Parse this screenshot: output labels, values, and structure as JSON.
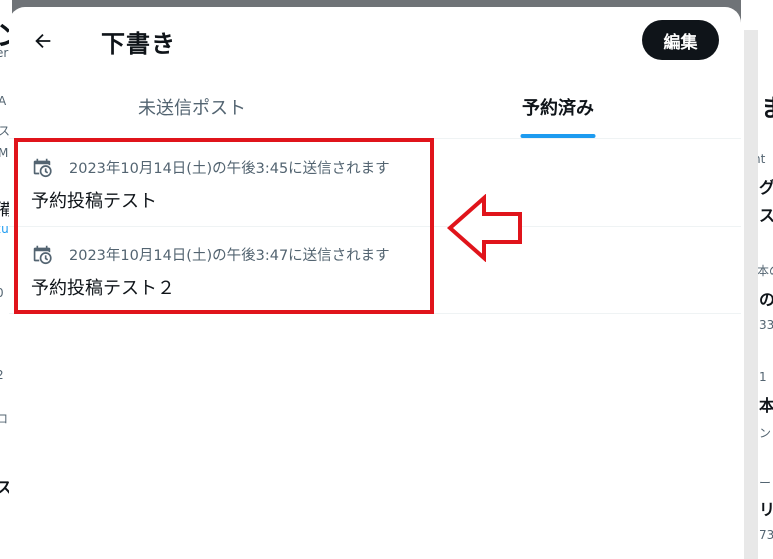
{
  "background": {
    "left_fragments": [
      "ン",
      "er",
      "A",
      "ス",
      "M",
      "備",
      "xu",
      "0",
      "2",
      "ロ",
      "ス"
    ],
    "right_fragments": [
      "ま",
      "nt",
      "グ",
      "ス",
      "本の",
      "の",
      "33",
      "1",
      "本",
      "ン",
      "ー",
      "リ",
      "73"
    ]
  },
  "modal": {
    "back_icon": "arrow-left-icon",
    "title": "下書き",
    "edit_label": "編集",
    "tabs": [
      {
        "label": "未送信ポスト",
        "active": false
      },
      {
        "label": "予約済み",
        "active": true
      }
    ],
    "items": [
      {
        "icon": "schedule-clock-icon",
        "time": "2023年10月14日(土)の午後3:45に送信されます",
        "text": "予約投稿テスト"
      },
      {
        "icon": "schedule-clock-icon",
        "time": "2023年10月14日(土)の午後3:47に送信されます",
        "text": "予約投稿テスト２"
      }
    ]
  },
  "colors": {
    "accent": "#1d9bf0",
    "annotation": "#e0141b",
    "dark": "#0f1419",
    "muted": "#536471"
  }
}
